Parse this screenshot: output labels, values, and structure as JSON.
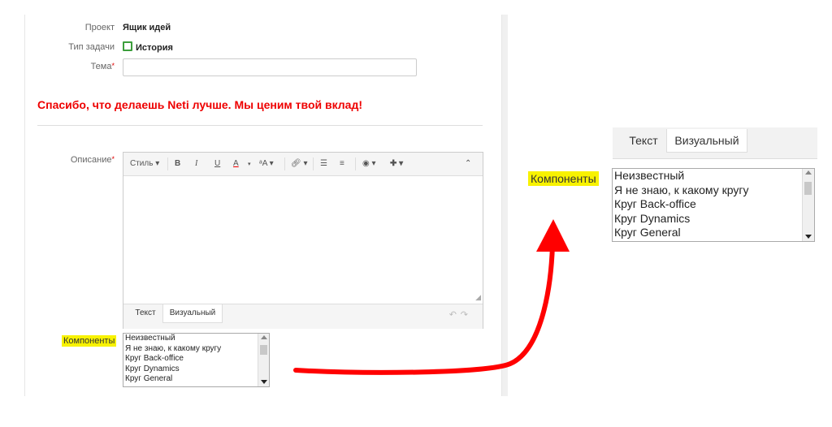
{
  "form": {
    "project_label": "Проект",
    "project_value": "Ящик идей",
    "type_label": "Тип задачи",
    "type_value": "История",
    "subject_label": "Тема",
    "required_mark": "*",
    "thanks_text": "Спасибо, что делаешь Neti лучше. Мы ценим твой вклад!",
    "description_label": "Описание"
  },
  "editor": {
    "style_label": "Стиль",
    "bold": "B",
    "italic": "I",
    "underline": "U",
    "font_color": "A",
    "font_size": "ᵃA",
    "tab_text": "Текст",
    "tab_visual": "Визуальный"
  },
  "components": {
    "label": "Компоненты",
    "options": [
      "Неизвестный",
      "Я не знаю, к какому кругу",
      "Круг Back-office",
      "Круг Dynamics",
      "Круг General"
    ]
  },
  "colors": {
    "highlight": "#f8f200",
    "arrow": "#ff0000",
    "thanks": "#e00000",
    "story_icon": "#3c9e3c"
  }
}
